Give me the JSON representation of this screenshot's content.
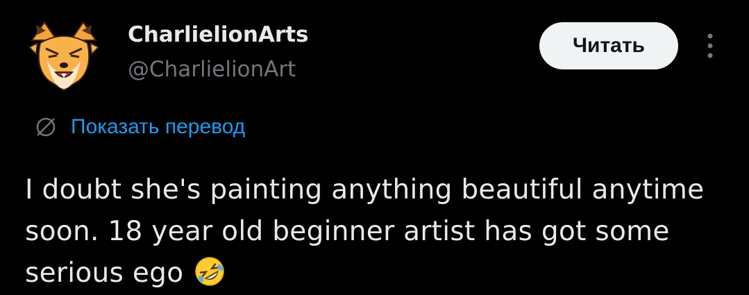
{
  "author": {
    "display_name": "CharlielionArts",
    "handle": "@CharlielionArt",
    "avatar_icon": "cartoon-fox-avatar"
  },
  "actions": {
    "follow_label": "Читать",
    "more_icon": "vertical-ellipsis-icon"
  },
  "translate": {
    "icon": "globe-icon",
    "label": "Показать перевод"
  },
  "tweet": {
    "text": "I doubt she's painting anything beautiful anytime soon. 18 year old beginner artist has got some serious ego",
    "emoji": "rolling-on-floor-laughing"
  },
  "colors": {
    "background": "#000000",
    "text_primary": "#e7e9ea",
    "text_secondary": "#71767b",
    "link": "#1d9bf0",
    "button_bg": "#eff3f4"
  }
}
